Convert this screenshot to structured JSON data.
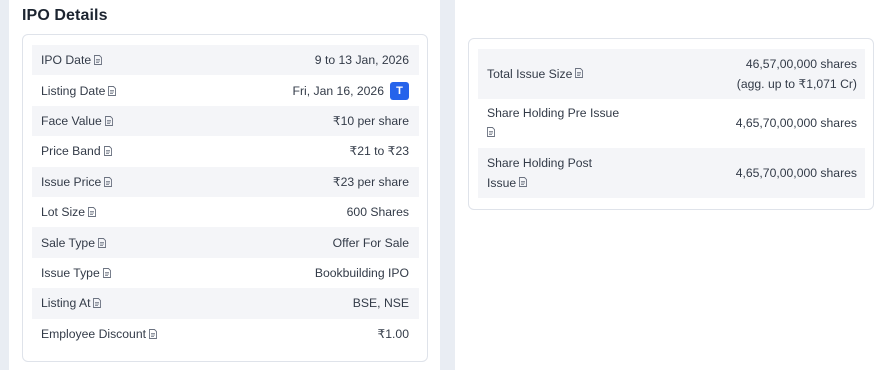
{
  "title": "IPO Details",
  "colors": {
    "accent": "#2563eb",
    "row_alt": "#f4f5f8",
    "page_bg": "#e9edf3"
  },
  "details": [
    {
      "label": "IPO Date",
      "value": "9 to 13 Jan, 2026"
    },
    {
      "label": "Listing Date",
      "value": "Fri, Jan 16, 2026",
      "badge": "T"
    },
    {
      "label": "Face Value",
      "value": "₹10 per share"
    },
    {
      "label": "Price Band",
      "value": "₹21 to ₹23"
    },
    {
      "label": "Issue Price",
      "value": "₹23 per share"
    },
    {
      "label": "Lot Size",
      "value": "600 Shares"
    },
    {
      "label": "Sale Type",
      "value": "Offer For Sale"
    },
    {
      "label": "Issue Type",
      "value": "Bookbuilding IPO"
    },
    {
      "label": "Listing At",
      "value": "BSE, NSE"
    },
    {
      "label": "Employee Discount",
      "value": "₹1.00"
    }
  ],
  "issue": [
    {
      "label": "Total Issue Size",
      "value": "46,57,00,000 shares",
      "sub": "(agg. up to ₹1,071 Cr)"
    },
    {
      "label_line1": "Share Holding Pre Issue",
      "label_line2": "",
      "value": "4,65,70,00,000 shares"
    },
    {
      "label_line1": "Share Holding Post",
      "label_line2": "Issue",
      "value": "4,65,70,00,000 shares"
    }
  ],
  "icons": {
    "info": "document-icon",
    "listing_badge": "t-badge-icon"
  }
}
